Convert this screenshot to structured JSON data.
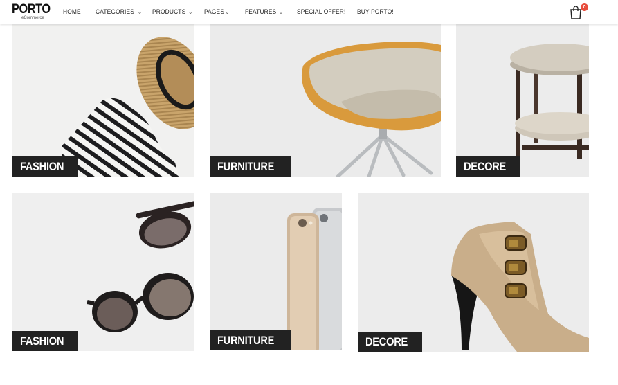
{
  "header": {
    "logo": {
      "title": "PORTO",
      "subtitle": "eCommerce"
    },
    "nav": [
      {
        "label": "HOME",
        "has_dropdown": false
      },
      {
        "label": "CATEGORIES",
        "has_dropdown": true
      },
      {
        "label": "PRODUCTS",
        "has_dropdown": true
      },
      {
        "label": "PAGES",
        "has_dropdown": true
      },
      {
        "label": "FEATURES",
        "has_dropdown": true
      },
      {
        "label": "SPECIAL OFFER!",
        "has_dropdown": false
      },
      {
        "label": "BUY PORTO!",
        "has_dropdown": false
      }
    ],
    "cart": {
      "icon": "shopping-bag-icon",
      "count": "0",
      "badge_color": "#e74c3c"
    }
  },
  "tiles": [
    {
      "label": "FASHION",
      "image": "hat-striped-shirt"
    },
    {
      "label": "FURNITURE",
      "image": "chair"
    },
    {
      "label": "DECORE",
      "image": "side-table"
    },
    {
      "label": "FASHION",
      "image": "sunglasses"
    },
    {
      "label": "FURNITURE",
      "image": "phones"
    },
    {
      "label": "DECORE",
      "image": "ankle-boot"
    }
  ],
  "colors": {
    "label_bg": "#222222",
    "label_text": "#ffffff",
    "tile_bg": "#ececec"
  }
}
